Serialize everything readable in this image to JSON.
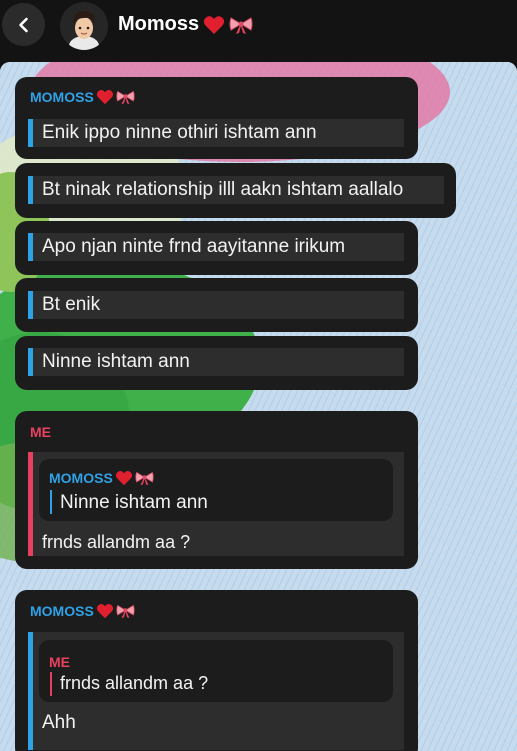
{
  "header": {
    "title": "Momoss",
    "title_emoji": "heart-bow",
    "back_icon": "chevron-left-icon",
    "avatar": "avatar"
  },
  "colors": {
    "momoss_name": "#2fa2e6",
    "me_name": "#e8415f",
    "bubble": "#1c1c1c",
    "quote_bg": "#2d2d2d"
  },
  "messages": [
    {
      "sender": "MOMOSS",
      "lines": [
        "Enik ippo ninne othiri ishtam ann",
        "Bt ninak relationship illl aakn ishtam aallalo",
        "Apo njan ninte frnd aayitanne irikum",
        "Bt enik",
        "Ninne ishtam ann"
      ]
    },
    {
      "sender": "ME",
      "reply_to": {
        "sender": "MOMOSS",
        "text": "Ninne ishtam ann"
      },
      "text": "frnds allandm aa ?"
    },
    {
      "sender": "MOMOSS",
      "reply_to": {
        "sender": "ME",
        "text": "frnds allandm aa ?"
      },
      "text": "Ahh"
    }
  ]
}
